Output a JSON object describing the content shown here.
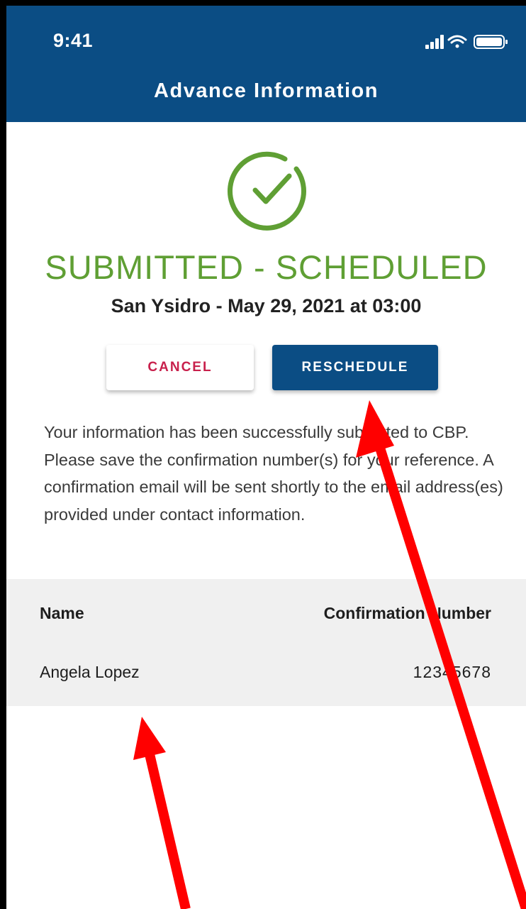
{
  "status_bar": {
    "time": "9:41",
    "icons": [
      "cellular-signal-icon",
      "wifi-icon",
      "battery-icon"
    ]
  },
  "header": {
    "title": "Advance Information"
  },
  "confirmation": {
    "icon": "check-circle-icon",
    "status": "SUBMITTED - SCHEDULED",
    "schedule": "San Ysidro - May 29, 2021 at 03:00",
    "cancel_label": "CANCEL",
    "reschedule_label": "RESCHEDULE",
    "message": "Your information has been successfully submitted to CBP. Please save the confirmation number(s) for your reference.  A confirmation email will be sent shortly to the email address(es) provided under contact information."
  },
  "table": {
    "headers": {
      "name": "Name",
      "confirmation_number": "Confirmation Number"
    },
    "rows": [
      {
        "name": "Angela Lopez",
        "confirmation_number": "12345678"
      }
    ]
  },
  "annotations": {
    "arrow_color": "#ff0000",
    "arrows": [
      "arrow-to-reschedule-button",
      "arrow-to-name-row"
    ]
  },
  "colors": {
    "header_bg": "#0b4d84",
    "success_green": "#5f9f34",
    "cancel_red": "#c8204c",
    "table_bg": "#f0f0f0"
  }
}
